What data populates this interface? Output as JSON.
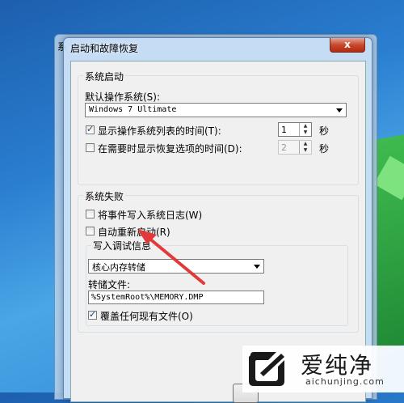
{
  "outer_window": {
    "title": "系"
  },
  "dialog": {
    "title": "启动和故障恢复",
    "close_label": "x"
  },
  "system_startup": {
    "group_label": "系统启动",
    "default_os_label": "默认操作系统(S):",
    "default_os_value": "Windows 7 Ultimate",
    "show_list": {
      "checked": true,
      "label": "显示操作系统列表的时间(T):",
      "value": "1",
      "unit": "秒"
    },
    "show_recovery": {
      "checked": false,
      "label": "在需要时显示恢复选项的时间(D):",
      "value": "2",
      "unit": "秒"
    }
  },
  "system_failure": {
    "group_label": "系统失败",
    "write_event": {
      "checked": false,
      "label": "将事件写入系统日志(W)"
    },
    "auto_restart": {
      "checked": false,
      "label": "自动重新启动(R)"
    },
    "debug_group_label": "写入调试信息",
    "debug_type_value": "核心内存转储",
    "dump_file_label": "转储文件:",
    "dump_file_value": "%SystemRoot%\\MEMORY.DMP",
    "overwrite": {
      "checked": true,
      "label": "覆盖任何现有文件(O)"
    }
  },
  "watermark": {
    "brand_text": "爱纯净",
    "url": "aichunjing.com"
  },
  "colors": {
    "annotation_arrow": "#e23a3a",
    "title_close_red": "#c7492e"
  }
}
